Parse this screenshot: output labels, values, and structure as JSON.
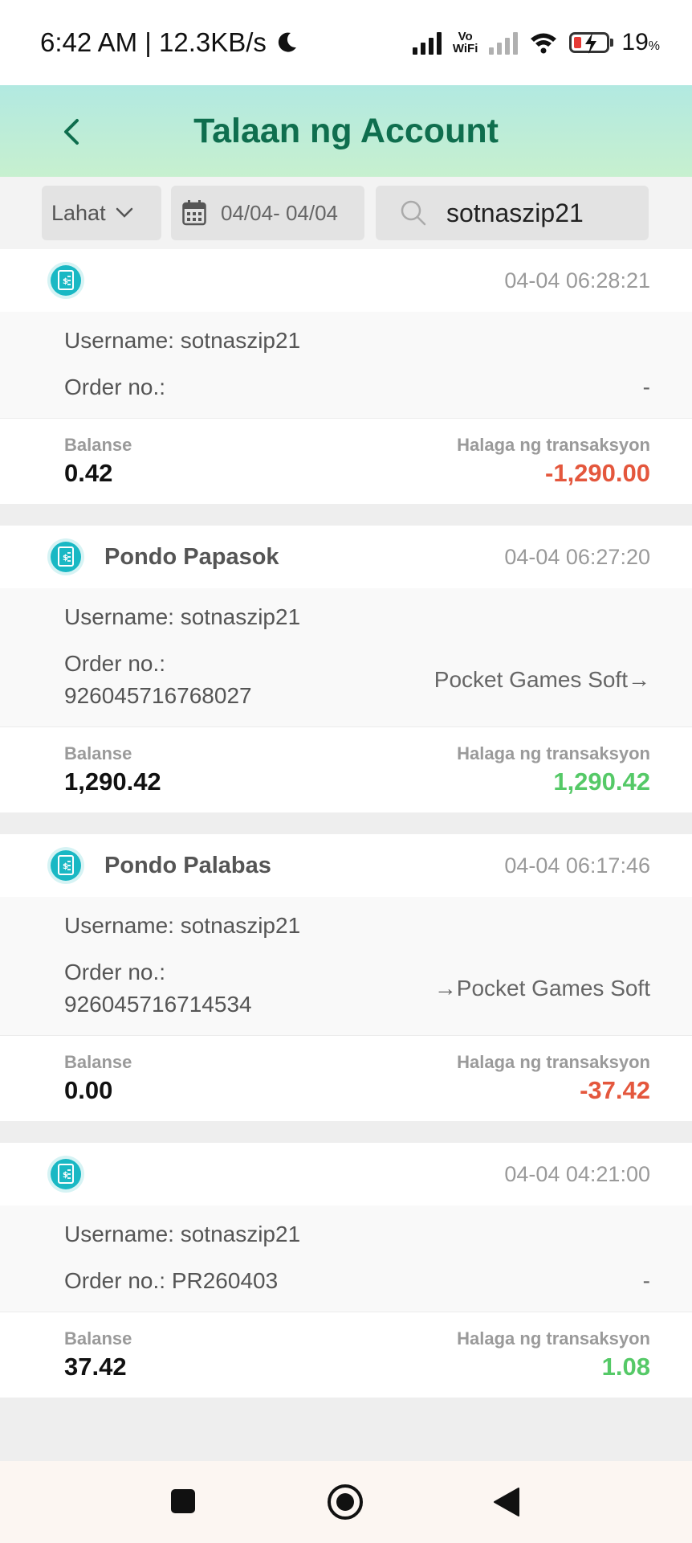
{
  "status_bar": {
    "time": "6:42 AM | 12.3KB/s",
    "vowifi_top": "Vo",
    "vowifi_bottom": "WiFi",
    "battery_percent": "19",
    "battery_unit": "%"
  },
  "header": {
    "title": "Talaan ng Account"
  },
  "filters": {
    "type_selected": "Lahat",
    "date_range": "04/04- 04/04",
    "search_value": "sotnaszip21"
  },
  "labels": {
    "username_prefix": "Username: ",
    "order_prefix": "Order no.:",
    "balance": "Balanse",
    "amount": "Halaga ng transaksyon"
  },
  "transactions": [
    {
      "type": "",
      "time": "04-04 06:28:21",
      "username": "Username: sotnaszip21",
      "order_label": "Order no.:",
      "order_no": "",
      "target": "-",
      "balance": "0.42",
      "amount": "-1,290.00",
      "amount_sign": "neg"
    },
    {
      "type": "Pondo Papasok",
      "time": "04-04 06:27:20",
      "username": "Username: sotnaszip21",
      "order_label": "Order no.:",
      "order_no": "926045716768027",
      "target": "Pocket Games Soft→",
      "balance": "1,290.42",
      "amount": "1,290.42",
      "amount_sign": "pos"
    },
    {
      "type": "Pondo Palabas",
      "time": "04-04 06:17:46",
      "username": "Username: sotnaszip21",
      "order_label": "Order no.:",
      "order_no": "926045716714534",
      "target": "→Pocket Games Soft",
      "balance": "0.00",
      "amount": "-37.42",
      "amount_sign": "neg"
    },
    {
      "type": "",
      "time": "04-04 04:21:00",
      "username": "Username: sotnaszip21",
      "order_label": "Order no.: PR260403",
      "order_no": "",
      "target": "-",
      "balance": "37.42",
      "amount": "1.08",
      "amount_sign": "pos"
    }
  ],
  "colors": {
    "title_green": "#0f6e4e",
    "negative": "#e4573d",
    "positive": "#55c967",
    "icon_teal": "#19b8c4"
  }
}
